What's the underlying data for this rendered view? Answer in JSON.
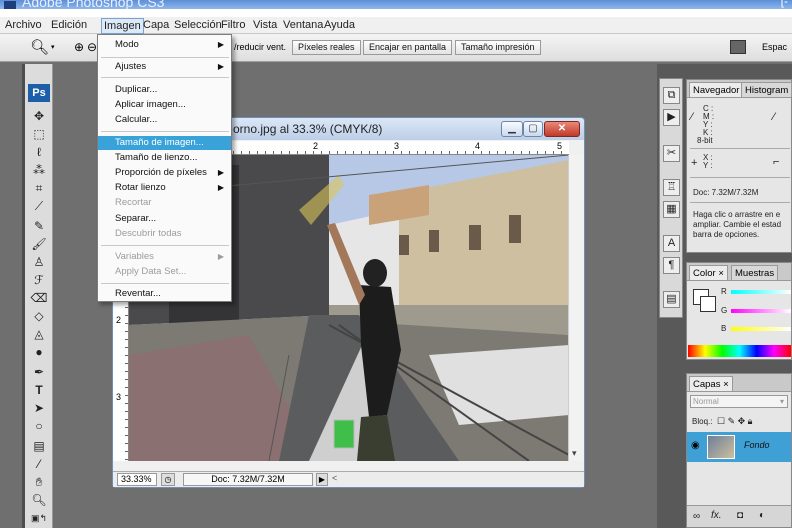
{
  "app": {
    "title": "Adobe Photoshop CS3",
    "window_ctrl": "[-"
  },
  "menubar": {
    "items": [
      "Archivo",
      "Edición",
      "Imagen",
      "Capa",
      "Selección",
      "Filtro",
      "Vista",
      "Ventana",
      "Ayuda"
    ]
  },
  "options": {
    "zoom_fit_text": "/reducir vent.",
    "buttons": [
      "Píxeles reales",
      "Encajar en pantalla",
      "Tamaño impresión"
    ],
    "workspace_label": "Espac"
  },
  "toolbox": {
    "logo": "Ps"
  },
  "document": {
    "title": "orno.jpg al 33.3% (CMYK/8)",
    "ruler_h_marks": [
      "1",
      "2",
      "3",
      "4",
      "5"
    ],
    "ruler_v_marks": [
      "1",
      "2",
      "3"
    ],
    "zoom": "33.33%",
    "doc_info": "Doc: 7.32M/7.32M",
    "scroll_left": "<"
  },
  "image_menu": {
    "items": [
      {
        "label": "Modo",
        "submenu": true,
        "disabled": false
      },
      {
        "label": "Ajustes",
        "submenu": true,
        "disabled": false
      },
      {
        "label": "Duplicar...",
        "submenu": false,
        "disabled": false
      },
      {
        "label": "Aplicar imagen...",
        "submenu": false,
        "disabled": false
      },
      {
        "label": "Calcular...",
        "submenu": false,
        "disabled": false
      },
      {
        "label": "Tamaño de imagen...",
        "submenu": false,
        "disabled": false,
        "highlighted": true
      },
      {
        "label": "Tamaño de lienzo...",
        "submenu": false,
        "disabled": false
      },
      {
        "label": "Proporción de píxeles",
        "submenu": true,
        "disabled": false
      },
      {
        "label": "Rotar lienzo",
        "submenu": true,
        "disabled": false
      },
      {
        "label": "Recortar",
        "submenu": false,
        "disabled": true
      },
      {
        "label": "Separar...",
        "submenu": false,
        "disabled": false
      },
      {
        "label": "Descubrir todas",
        "submenu": false,
        "disabled": true
      },
      {
        "label": "Variables",
        "submenu": true,
        "disabled": true
      },
      {
        "label": "Apply Data Set...",
        "submenu": false,
        "disabled": true
      },
      {
        "label": "Reventar...",
        "submenu": false,
        "disabled": false
      }
    ]
  },
  "navigator_panel": {
    "tabs": [
      "Navegador",
      "Histogram"
    ],
    "cmyk_labels": [
      "C :",
      "M :",
      "Y :",
      "K :"
    ],
    "bit_depth": "8-bit",
    "xy_labels": [
      "X :",
      "Y :"
    ],
    "doc": "Doc: 7.32M/7.32M",
    "help": "Haga clic o arrastre en e ampliar. Cambie el estad barra de opciones."
  },
  "color_panel": {
    "tabs": [
      "Color",
      "Muestras"
    ],
    "channels": [
      "R",
      "G",
      "B"
    ]
  },
  "layers_panel": {
    "tab": "Capas",
    "blend_mode": "Normal",
    "lock_label": "Bloq.:",
    "layer_name": "Fondo",
    "footer": "fx."
  },
  "colors": {
    "accent": "#39a3d9",
    "layer_selected": "#3fa0d6"
  }
}
